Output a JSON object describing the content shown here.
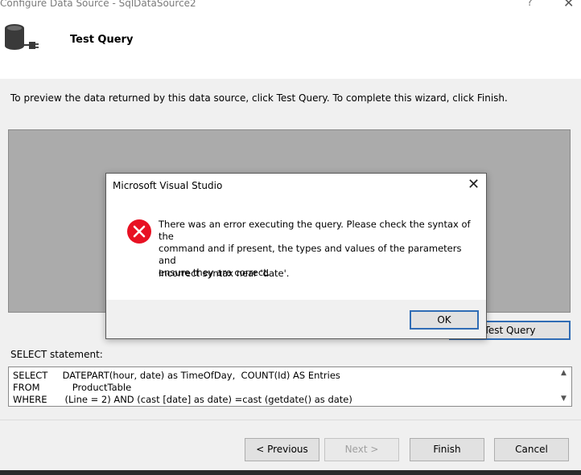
{
  "window": {
    "title": "Configure Data Source - SqlDataSource2",
    "help_glyph": "?",
    "close_glyph": "✕"
  },
  "header": {
    "icon": "database-connection-icon",
    "heading": "Test Query"
  },
  "instructions": "To preview the data returned by this data source, click Test Query. To complete this wizard, click Finish.",
  "test_query_button": "Test Query",
  "select_statement": {
    "label": "SELECT statement:",
    "lines": [
      "SELECT     DATEPART(hour, date) as TimeOfDay,  COUNT(Id) AS Entries",
      "FROM           ProductTable",
      "WHERE      (Line = 2) AND (cast [date] as date) =cast (getdate() as date)"
    ]
  },
  "footer": {
    "previous": "< Previous",
    "next": "Next >",
    "finish": "Finish",
    "cancel": "Cancel"
  },
  "dialog": {
    "title": "Microsoft Visual Studio",
    "close_glyph": "✕",
    "icon": "error-icon",
    "message_lines": [
      "There was an error executing the query. Please check the syntax of the",
      "command and if present, the types and values of the parameters and",
      "ensure they are correct."
    ],
    "detail": "Incorrect syntax near 'date'.",
    "ok": "OK"
  },
  "colors": {
    "accent": "#2f6cb5",
    "error": "#e81123",
    "preview_bg": "#ababab"
  }
}
